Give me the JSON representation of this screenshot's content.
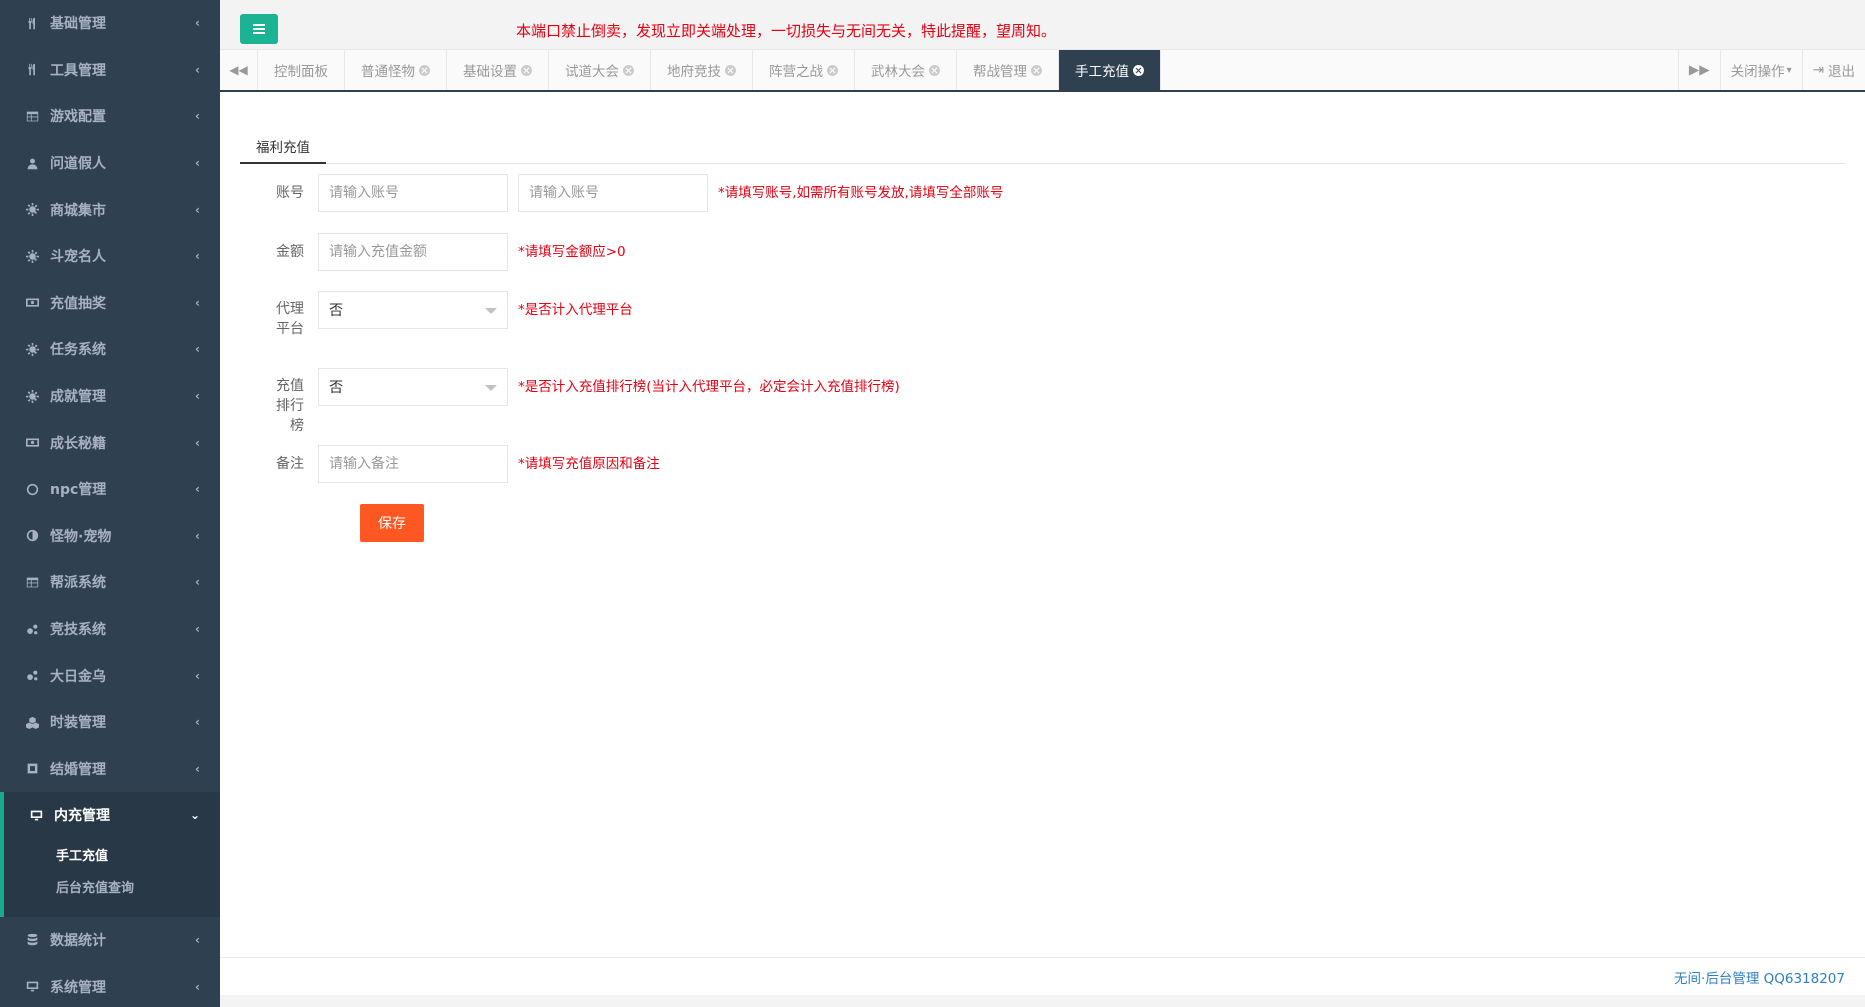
{
  "sidebar": {
    "items": [
      {
        "label": "基础管理",
        "icon": "cutlery-icon"
      },
      {
        "label": "工具管理",
        "icon": "cutlery-icon"
      },
      {
        "label": "游戏配置",
        "icon": "table-icon"
      },
      {
        "label": "问道假人",
        "icon": "user-icon"
      },
      {
        "label": "商城集市",
        "icon": "gear-icon"
      },
      {
        "label": "斗宠名人",
        "icon": "gear-icon"
      },
      {
        "label": "充值抽奖",
        "icon": "money-icon"
      },
      {
        "label": "任务系统",
        "icon": "gear-icon"
      },
      {
        "label": "成就管理",
        "icon": "gear-icon"
      },
      {
        "label": "成长秘籍",
        "icon": "money-icon"
      },
      {
        "label": "npc管理",
        "icon": "circle-icon"
      },
      {
        "label": "怪物·宠物",
        "icon": "half-circle-icon"
      },
      {
        "label": "帮派系统",
        "icon": "table-icon"
      },
      {
        "label": "竞技系统",
        "icon": "gears-icon"
      },
      {
        "label": "大日金乌",
        "icon": "gears-icon"
      },
      {
        "label": "时装管理",
        "icon": "cubes-icon"
      },
      {
        "label": "结婚管理",
        "icon": "square-icon"
      }
    ],
    "active": {
      "label": "内充管理",
      "icon": "desktop-icon",
      "sub": [
        "手工充值",
        "后台充值查询"
      ]
    },
    "bottom": [
      {
        "label": "数据统计",
        "icon": "database-icon"
      },
      {
        "label": "系统管理",
        "icon": "desktop-icon"
      }
    ]
  },
  "topbar": {
    "notice": "本端口禁止倒卖，发现立即关端处理，一切损失与无间无关，特此提醒，望周知。"
  },
  "tabs": {
    "items": [
      "控制面板",
      "普通怪物",
      "基础设置",
      "试道大会",
      "地府竞技",
      "阵营之战",
      "武林大会",
      "帮战管理",
      "手工充值"
    ],
    "active": "手工充值",
    "close_ops": "关闭操作",
    "logout": "退出"
  },
  "form": {
    "subtab": "福利充值",
    "account_label": "账号",
    "account_placeholder": "请输入账号",
    "account_placeholder2": "请输入账号",
    "account_hint": "*请填写账号,如需所有账号发放,请填写全部账号",
    "amount_label": "金额",
    "amount_placeholder": "请输入充值金额",
    "amount_hint": "*请填写金额应>0",
    "agent_label": "代理平台",
    "agent_value": "否",
    "agent_hint": "*是否计入代理平台",
    "rank_label": "充值排行榜",
    "rank_value": "否",
    "rank_hint": "*是否计入充值排行榜(当计入代理平台，必定会计入充值排行榜)",
    "remark_label": "备注",
    "remark_placeholder": "请输入备注",
    "remark_hint": "*请填写充值原因和备注",
    "save_label": "保存"
  },
  "footer": {
    "text": "无间·后台管理 QQ6318207"
  },
  "colors": {
    "sidebar_bg": "#2f4050",
    "accent": "#1ab394",
    "save": "#ff5722",
    "notice": "#e60012"
  }
}
